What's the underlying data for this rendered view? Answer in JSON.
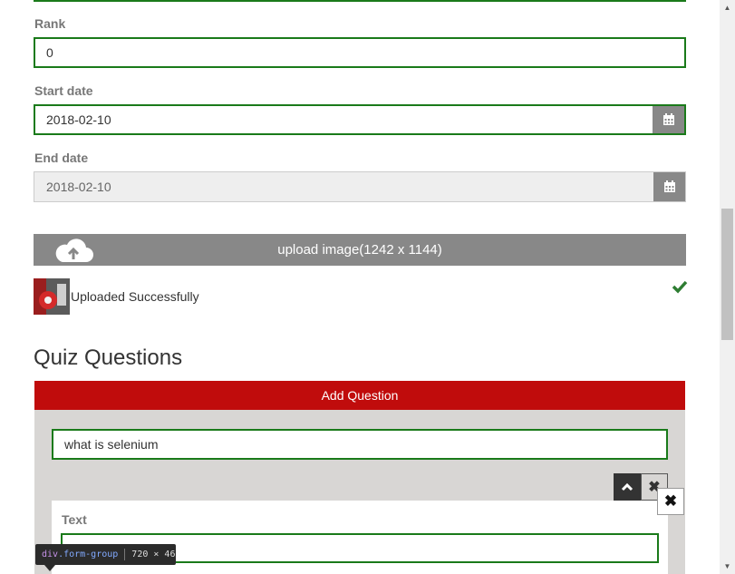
{
  "form": {
    "rank": {
      "label": "Rank",
      "value": "0"
    },
    "start_date": {
      "label": "Start date",
      "value": "2018-02-10"
    },
    "end_date": {
      "label": "End date",
      "value": "2018-02-10"
    }
  },
  "upload": {
    "button_label": "upload image(1242 x 1144)",
    "status_text": "Uploaded Successfully",
    "icon": "cloud-upload-icon",
    "status_icon": "check-icon"
  },
  "quiz": {
    "title": "Quiz Questions",
    "add_question_label": "Add Question",
    "question_value": "what is selenium",
    "text_label": "Text",
    "text_value": ""
  },
  "devtools_tooltip": {
    "tag": "div",
    "class": ".form-group",
    "dims": "720 × 46"
  },
  "colors": {
    "field_border": "#1a7a1a",
    "add_question_bg": "#c00c0c",
    "upload_bar_bg": "#888888",
    "panel_bg": "#d8d6d4",
    "success_check": "#2e7d32"
  }
}
